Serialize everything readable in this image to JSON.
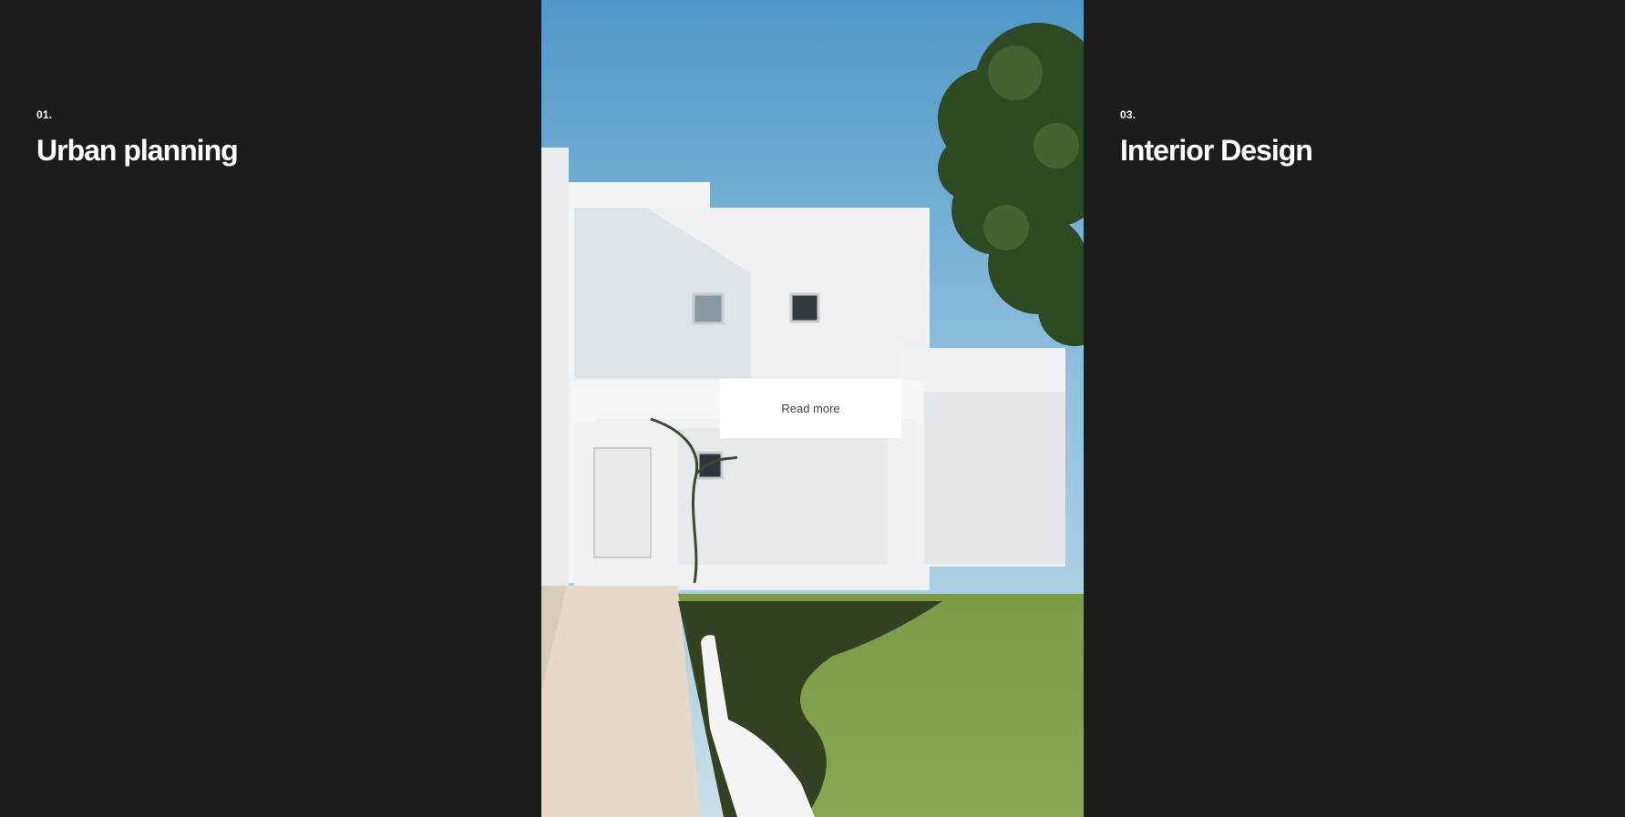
{
  "panels": [
    {
      "number": "01.",
      "title": "Urban planning"
    },
    {
      "read_more_label": "Read more"
    },
    {
      "number": "03.",
      "title": "Interior Design"
    }
  ],
  "colors": {
    "background": "#1c1c1c",
    "text": "#ffffff",
    "button_bg": "#ffffff",
    "button_text": "#444444"
  }
}
